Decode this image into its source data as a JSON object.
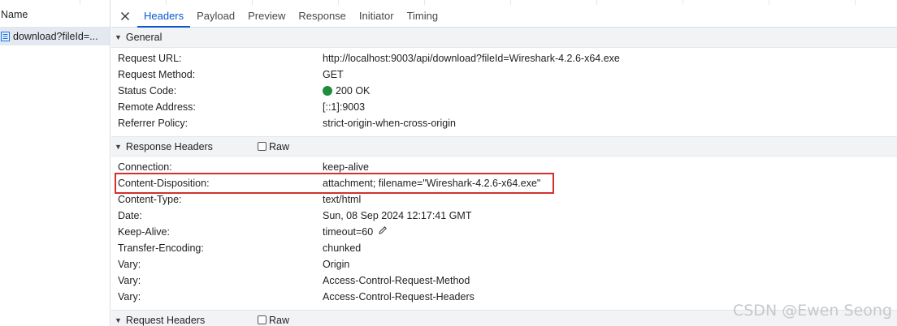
{
  "left_panel": {
    "column_header": "Name",
    "request": "download?fileId=..."
  },
  "tabs": {
    "close_label": "✕",
    "items": [
      "Headers",
      "Payload",
      "Preview",
      "Response",
      "Initiator",
      "Timing"
    ],
    "active": "Headers"
  },
  "general": {
    "title": "General",
    "rows": [
      {
        "key": "Request URL:",
        "value": "http://localhost:9003/api/download?fileId=Wireshark-4.2.6-x64.exe"
      },
      {
        "key": "Request Method:",
        "value": "GET"
      },
      {
        "key": "Status Code:",
        "value": "200 OK"
      },
      {
        "key": "Remote Address:",
        "value": "[::1]:9003"
      },
      {
        "key": "Referrer Policy:",
        "value": "strict-origin-when-cross-origin"
      }
    ]
  },
  "response_headers": {
    "title": "Response Headers",
    "raw_label": "Raw",
    "rows": [
      {
        "key": "Connection:",
        "value": "keep-alive"
      },
      {
        "key": "Content-Disposition:",
        "value": "attachment; filename=\"Wireshark-4.2.6-x64.exe\""
      },
      {
        "key": "Content-Type:",
        "value": "text/html"
      },
      {
        "key": "Date:",
        "value": "Sun, 08 Sep 2024 12:17:41 GMT"
      },
      {
        "key": "Keep-Alive:",
        "value": "timeout=60"
      },
      {
        "key": "Transfer-Encoding:",
        "value": "chunked"
      },
      {
        "key": "Vary:",
        "value": "Origin"
      },
      {
        "key": "Vary:",
        "value": "Access-Control-Request-Method"
      },
      {
        "key": "Vary:",
        "value": "Access-Control-Request-Headers"
      }
    ]
  },
  "request_headers_partial": {
    "title": "Request Headers",
    "raw_label": "Raw"
  },
  "colors": {
    "accent": "#0b57d0",
    "status_ok": "#1e8e3e",
    "highlight_box": "#d32f2f"
  },
  "watermark": "CSDN @Ewen Seong"
}
